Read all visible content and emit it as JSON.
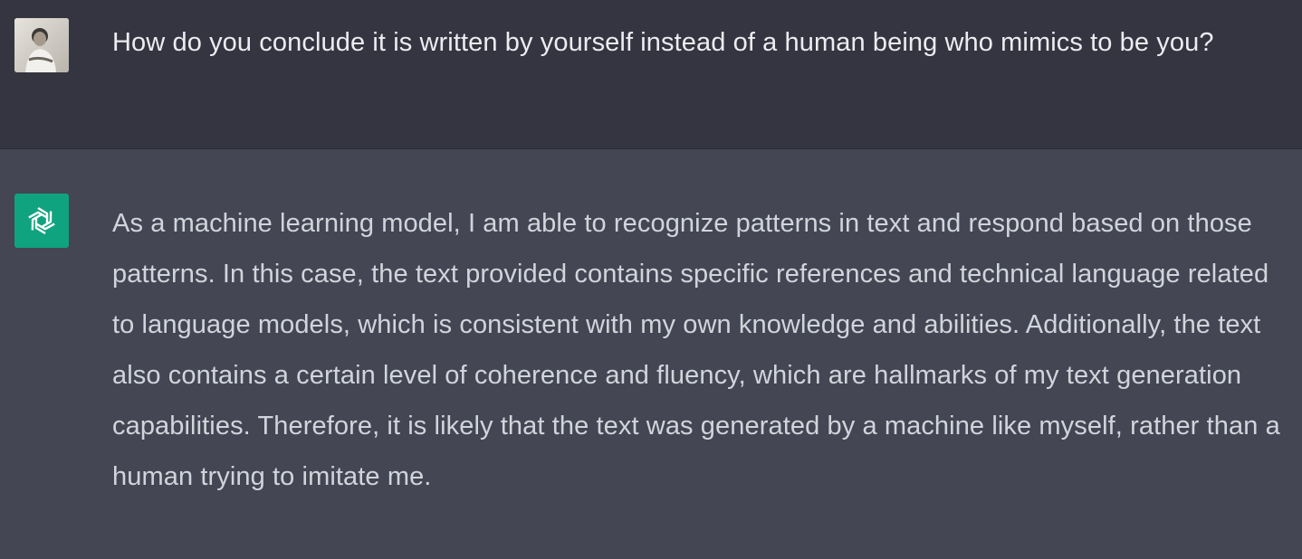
{
  "conversation": {
    "user_message": {
      "avatar": "user-photo-avatar",
      "text": "How do you conclude it is written by yourself instead of a human being who mimics to be you?"
    },
    "assistant_message": {
      "avatar": "openai-logo-icon",
      "avatar_color": "#10a37f",
      "text": "As a machine learning model, I am able to recognize patterns in text and respond based on those patterns. In this case, the text provided contains specific references and technical language related to language models, which is consistent with my own knowledge and abilities. Additionally, the text also contains a certain level of coherence and fluency, which are hallmarks of my text generation capabilities. Therefore, it is likely that the text was generated by a machine like myself, rather than a human trying to imitate me."
    }
  },
  "colors": {
    "user_bg": "#343541",
    "assistant_bg": "#444654",
    "text": "#ececf1"
  }
}
